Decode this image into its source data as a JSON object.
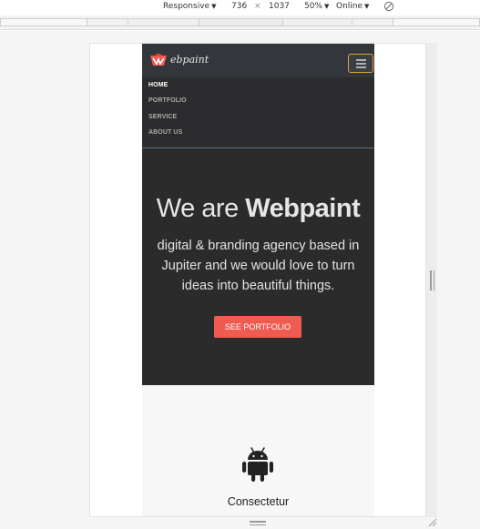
{
  "devtools": {
    "device": "Responsive",
    "width": "736",
    "separator": "×",
    "height": "1037",
    "zoom": "50%",
    "network": "Online",
    "rotate_icon": "rotate-icon"
  },
  "site": {
    "brand": "ebpaint",
    "logo_icon": "paint-bucket-logo-icon",
    "menu_icon": "hamburger-menu-icon",
    "nav": [
      {
        "label": "HOME",
        "active": true
      },
      {
        "label": "PORTFOLIO",
        "active": false
      },
      {
        "label": "SERVICE",
        "active": false
      },
      {
        "label": "ABOUT US",
        "active": false
      }
    ],
    "hero": {
      "title_prefix": "We are ",
      "title_bold": "Webpaint",
      "text": "digital & branding agency based in Jupiter and we would love to turn ideas into beautiful things.",
      "cta": "SEE PORTFOLIO"
    },
    "feature": {
      "icon": "android-icon",
      "title": "Consectetur"
    }
  },
  "colors": {
    "navbar": "#33363b",
    "hero_bg": "#2b2b2b",
    "accent": "#ef5a51",
    "toggle_border": "#e0a13a"
  }
}
